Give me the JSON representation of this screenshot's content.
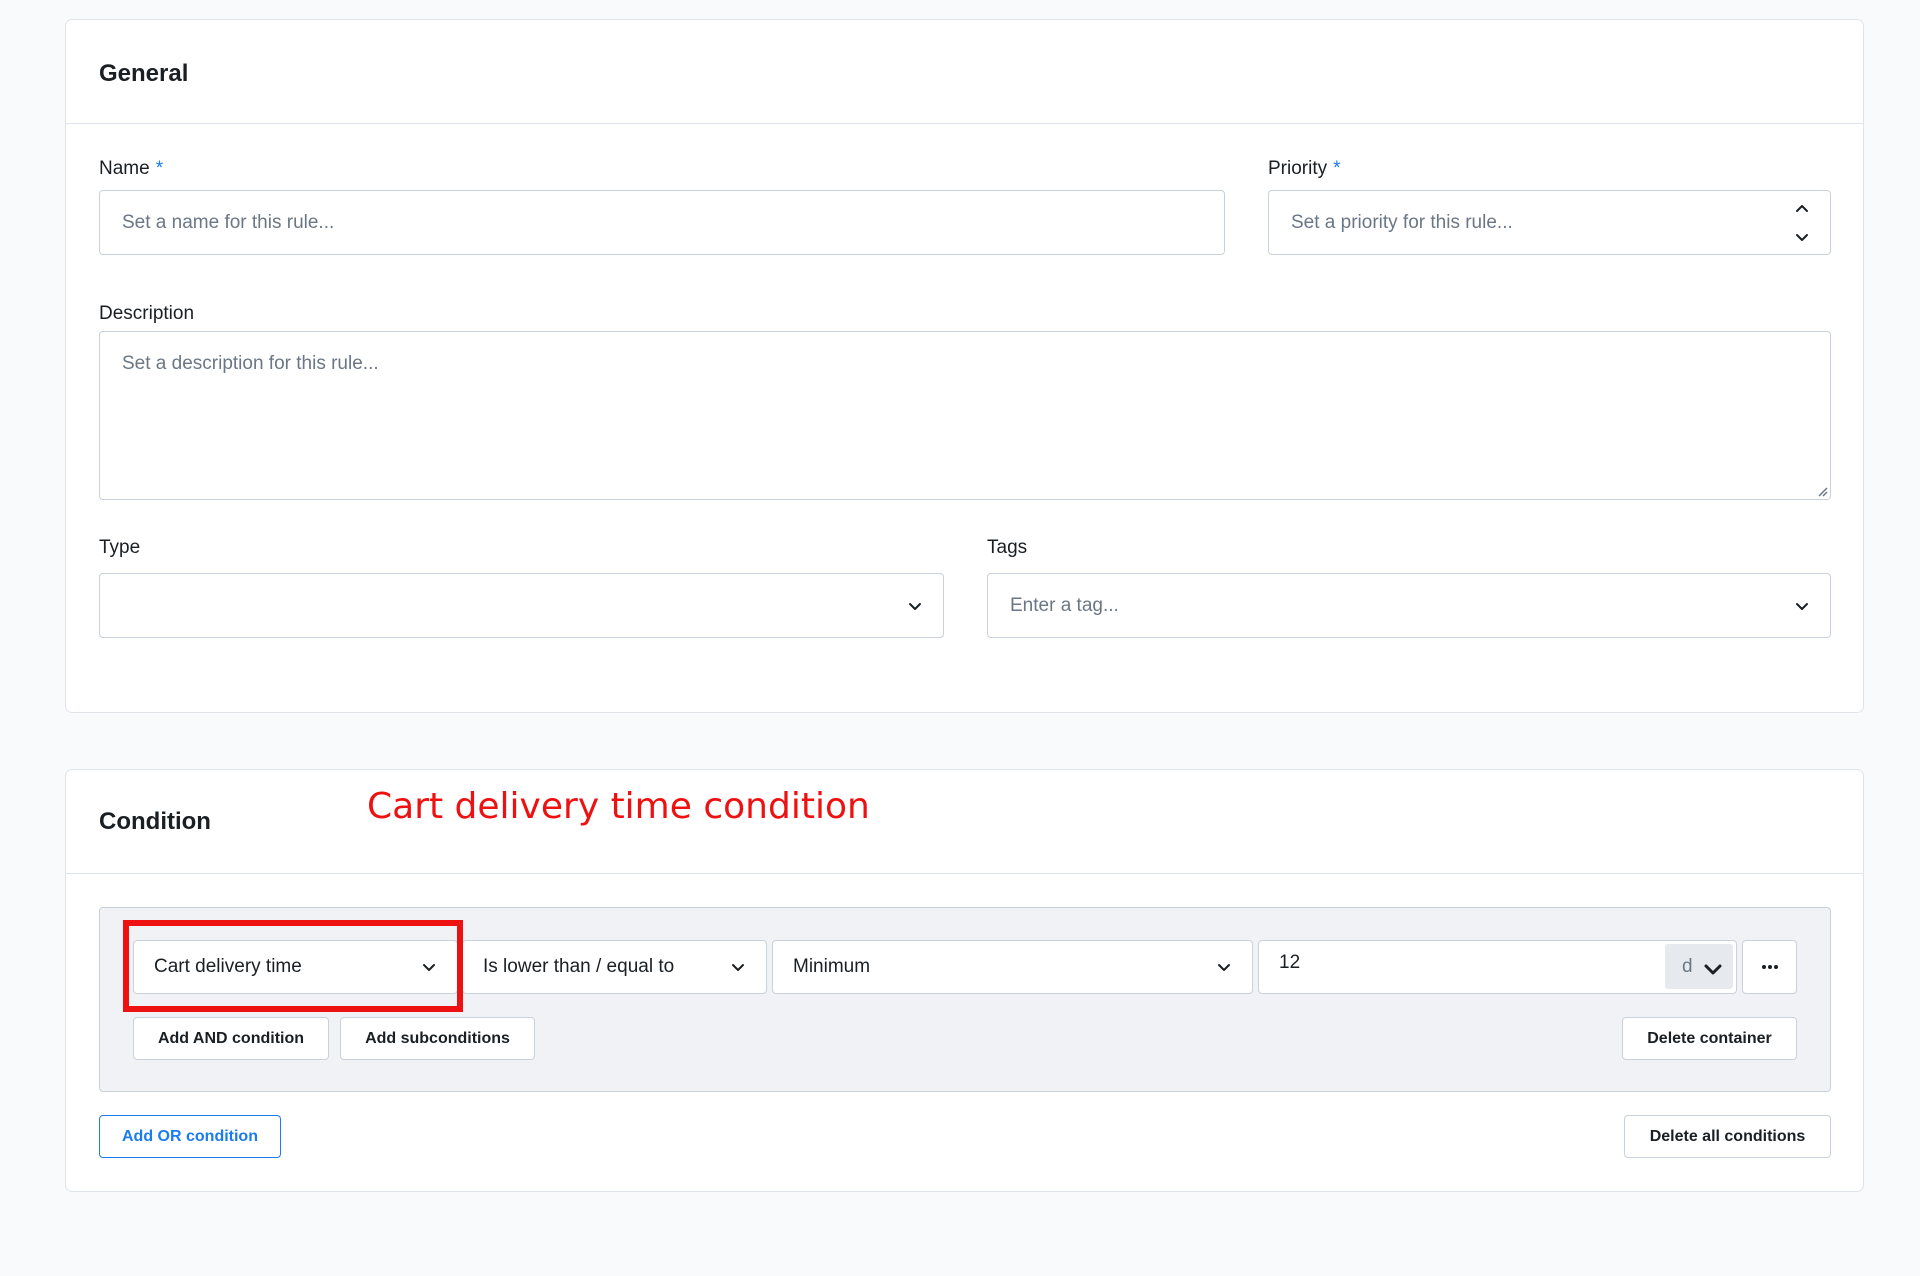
{
  "general": {
    "title": "General",
    "name": {
      "label": "Name",
      "required_mark": "*",
      "placeholder": "Set a name for this rule..."
    },
    "priority": {
      "label": "Priority",
      "required_mark": "*",
      "placeholder": "Set a priority for this rule..."
    },
    "description": {
      "label": "Description",
      "placeholder": "Set a description for this rule..."
    },
    "type": {
      "label": "Type",
      "value": ""
    },
    "tags": {
      "label": "Tags",
      "placeholder": "Enter a tag..."
    }
  },
  "condition": {
    "title": "Condition",
    "annotation": "Cart delivery time condition",
    "rule": {
      "condition_type": "Cart delivery time",
      "operator": "Is lower than / equal to",
      "aggregate": "Minimum",
      "value": "12",
      "unit": "d",
      "more_icon": "ellipsis-icon"
    },
    "buttons": {
      "add_and": "Add AND condition",
      "add_subconditions": "Add subconditions",
      "delete_container": "Delete container",
      "add_or": "Add OR condition",
      "delete_all": "Delete all conditions"
    }
  },
  "colors": {
    "accent": "#1b7bf0",
    "annotation": "#ee1111",
    "background": "#f9fafc",
    "container": "#f0f2f5",
    "border": "#c9d1da"
  }
}
